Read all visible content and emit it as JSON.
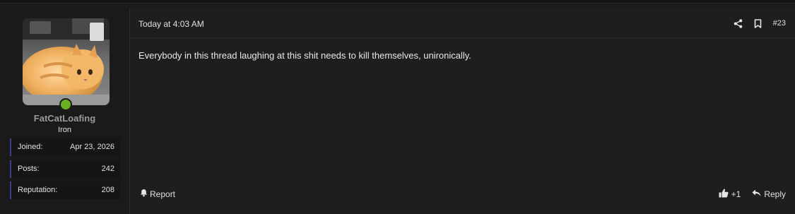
{
  "user": {
    "name": "FatCatLoafing",
    "title": "Iron",
    "online": true,
    "stats": [
      {
        "label": "Joined:",
        "value": "Apr 23, 2026"
      },
      {
        "label": "Posts:",
        "value": "242"
      },
      {
        "label": "Reputation:",
        "value": "208"
      }
    ]
  },
  "post": {
    "date": "Today at 4:03 AM",
    "number": "#23",
    "body": "Everybody in this thread laughing at this shit needs to kill themselves, unironically."
  },
  "actions": {
    "report": "Report",
    "like_count": "+1",
    "reply": "Reply"
  },
  "colors": {
    "online": "#6ab023",
    "stat_accent": "#3b3f8a"
  },
  "icons": [
    "share-icon",
    "bookmark-icon",
    "bell-icon",
    "thumbs-up-icon",
    "reply-icon"
  ]
}
